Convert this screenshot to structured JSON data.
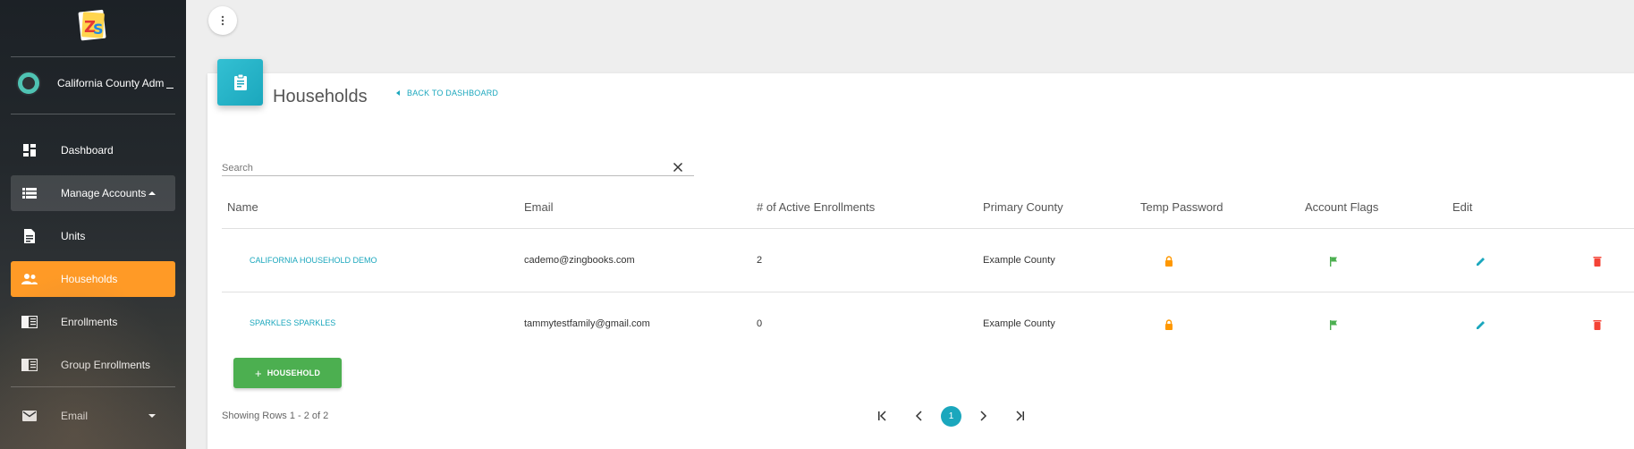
{
  "sidebar": {
    "logo_text": "ZS",
    "user_name": "California County Admin",
    "items": [
      {
        "label": "Dashboard",
        "icon": "dashboard-icon"
      },
      {
        "label": "Manage Accounts",
        "icon": "list-icon",
        "state": "expanded"
      },
      {
        "label": "Units",
        "icon": "document-icon"
      },
      {
        "label": "Households",
        "icon": "people-icon",
        "state": "active"
      },
      {
        "label": "Enrollments",
        "icon": "book-icon"
      },
      {
        "label": "Group Enrollments",
        "icon": "book-icon"
      },
      {
        "label": "Email",
        "icon": "mail-icon",
        "state": "collapsible"
      }
    ]
  },
  "page": {
    "title": "Households",
    "back_label": "BACK TO DASHBOARD"
  },
  "search": {
    "placeholder": "Search",
    "value": ""
  },
  "table": {
    "columns": [
      "Name",
      "Email",
      "# of Active Enrollments",
      "Primary County",
      "Temp Password",
      "Account Flags",
      "Edit"
    ],
    "rows": [
      {
        "name": "CALIFORNIA HOUSEHOLD DEMO",
        "email": "cademo@zingbooks.com",
        "active_enrollments": "2",
        "county": "Example County"
      },
      {
        "name": "SPARKLES SPARKLES",
        "email": "tammytestfamily@gmail.com",
        "active_enrollments": "0",
        "county": "Example County"
      }
    ]
  },
  "actions": {
    "add_label": "HOUSEHOLD"
  },
  "pagination": {
    "showing": "Showing Rows 1 - 2 of 2",
    "current_page": "1"
  },
  "colors": {
    "accent": "#1ba7bd",
    "active_nav": "#ff9a26",
    "add_button": "#4caf50",
    "lock": "#ff9800",
    "flag": "#4caf50",
    "delete": "#f44336"
  }
}
